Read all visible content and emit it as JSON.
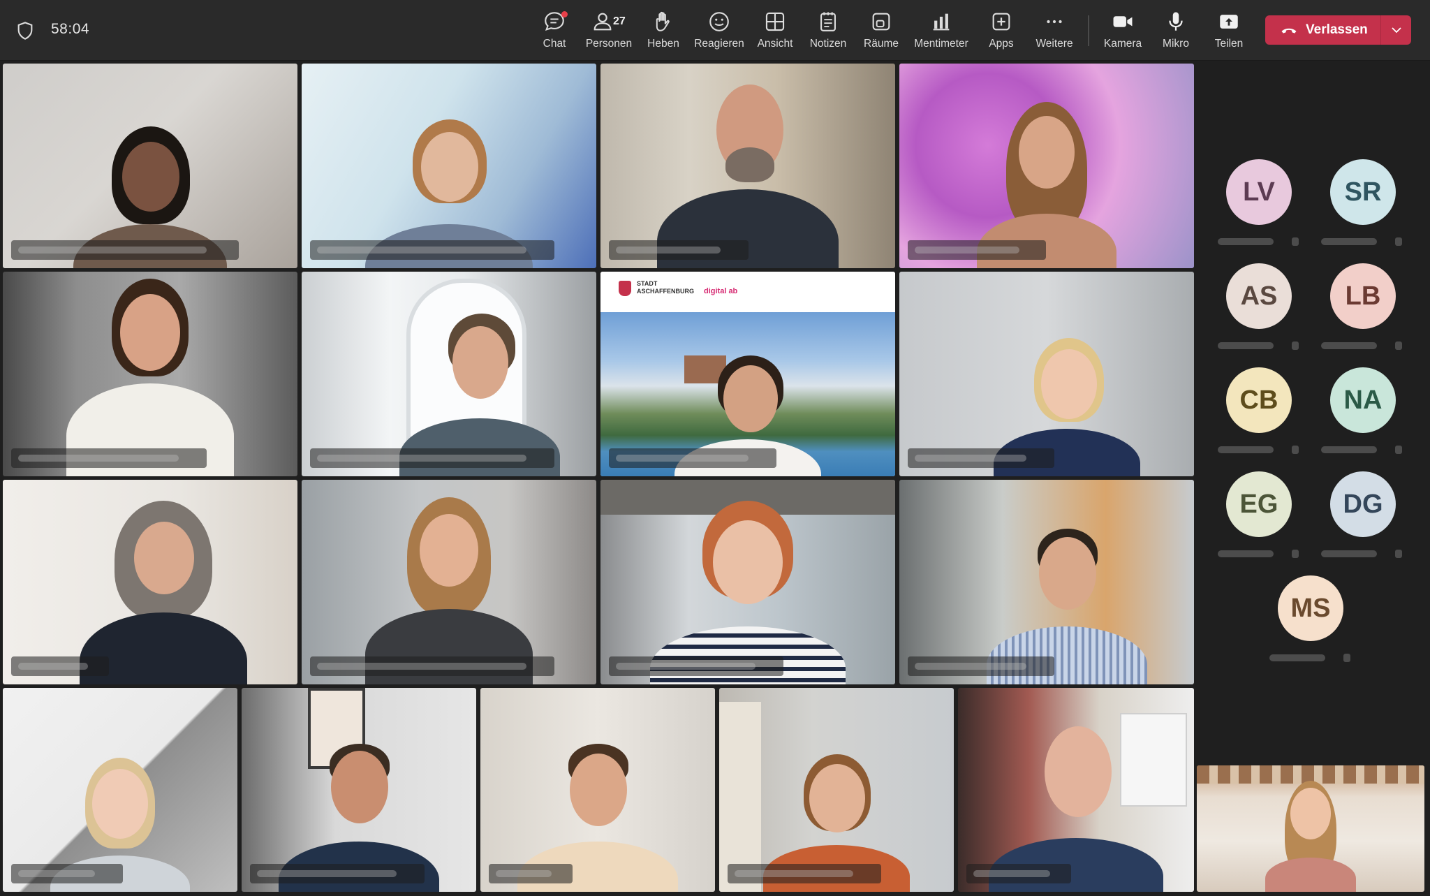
{
  "timer": "58:04",
  "toolbar": {
    "chat": "Chat",
    "people": "Personen",
    "people_count": "27",
    "raise": "Heben",
    "react": "Reagieren",
    "view": "Ansicht",
    "notes": "Notizen",
    "rooms": "Räume",
    "mentimeter": "Mentimeter",
    "apps": "Apps",
    "more": "Weitere",
    "camera": "Kamera",
    "mic": "Mikro",
    "share": "Teilen",
    "leave": "Verlassen"
  },
  "shared_slide": {
    "logo_line1": "STADT",
    "logo_line2": "ASCHAFFENBURG",
    "brand": "digital ab"
  },
  "participants_panel": [
    {
      "initials": "LV",
      "color": "#e8c9dd"
    },
    {
      "initials": "SR",
      "color": "#cfe6ea"
    },
    {
      "initials": "AS",
      "color": "#eaded8"
    },
    {
      "initials": "LB",
      "color": "#f2cfc9"
    },
    {
      "initials": "CB",
      "color": "#f3e6bd"
    },
    {
      "initials": "NA",
      "color": "#c9e6da"
    },
    {
      "initials": "EG",
      "color": "#e3e8d2"
    },
    {
      "initials": "DG",
      "color": "#d3dde6"
    },
    {
      "initials": "MS",
      "color": "#f6e0cc"
    }
  ],
  "colors": {
    "leave_button": "#c4314b",
    "topbar": "#2a2a2a",
    "background": "#1f1f1f"
  }
}
